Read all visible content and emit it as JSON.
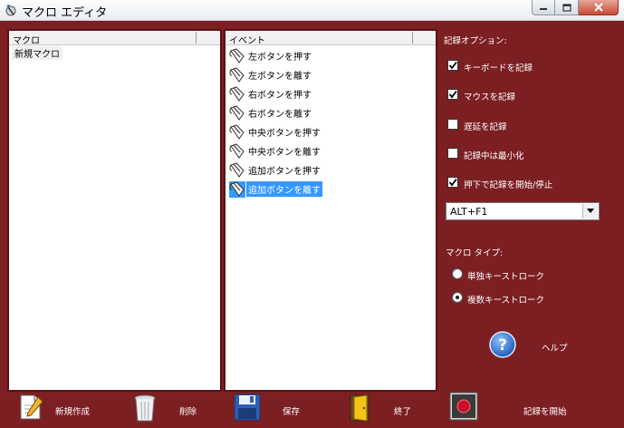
{
  "window": {
    "title": "マクロ エディタ"
  },
  "macro_panel": {
    "header": "マクロ",
    "items": [
      "新規マクロ"
    ]
  },
  "event_panel": {
    "header": "イベント",
    "events": [
      "左ボタンを押す",
      "左ボタンを離す",
      "右ボタンを押す",
      "右ボタンを離す",
      "中央ボタンを押す",
      "中央ボタンを離す",
      "追加ボタンを押す",
      "追加ボタンを離す"
    ],
    "selected_index": 7
  },
  "options": {
    "title": "記録オプション:",
    "checkboxes": [
      {
        "label": "キーボードを記録",
        "checked": true
      },
      {
        "label": "マウスを記録",
        "checked": true
      },
      {
        "label": "遅延を記録",
        "checked": false
      },
      {
        "label": "記録中は最小化",
        "checked": false
      },
      {
        "label": "押下で記録を開始/停止",
        "checked": true
      }
    ],
    "hotkey": "ALT+F1"
  },
  "macro_type": {
    "title": "マクロ タイプ:",
    "options": [
      {
        "label": "単独キーストローク",
        "selected": false
      },
      {
        "label": "複数キーストローク",
        "selected": true
      }
    ]
  },
  "help": {
    "label": "ヘルプ"
  },
  "toolbar": {
    "new_label": "新規作成",
    "delete_label": "削除",
    "save_label": "保存",
    "exit_label": "終了",
    "record_label": "記録を開始"
  },
  "colors": {
    "background": "#7c1f22",
    "selection": "#3399ff"
  }
}
